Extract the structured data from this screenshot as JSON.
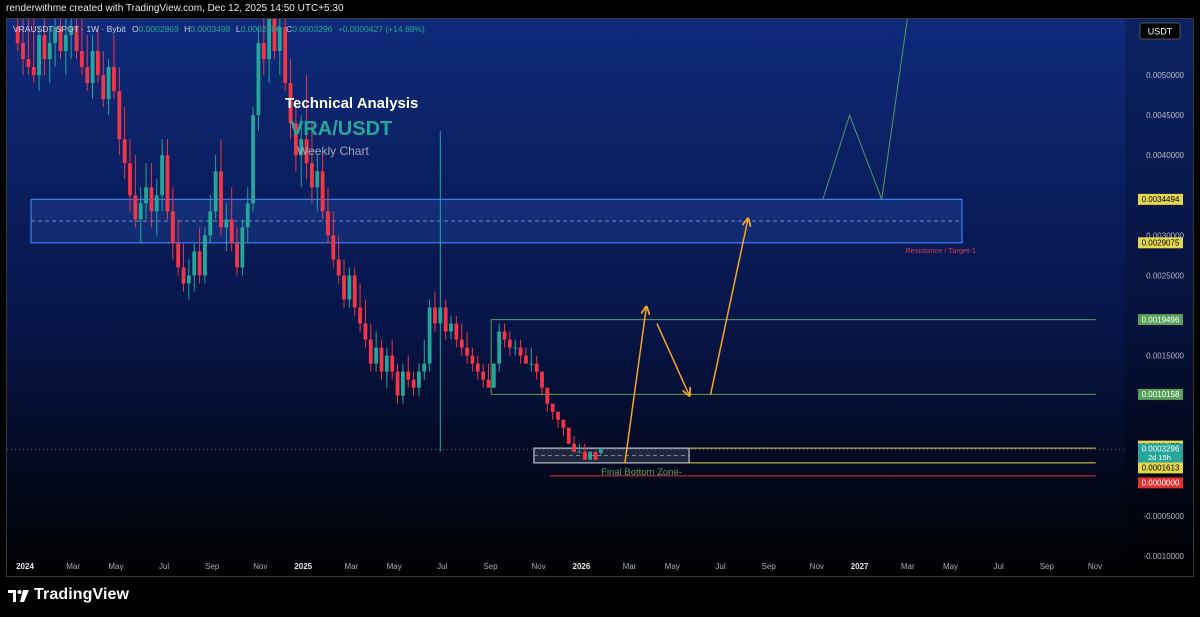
{
  "header_text": "renderwithme created with TradingView.com, Dec 12, 2025 14:50 UTC+5:30",
  "logo_text": "TradingView",
  "colors": {
    "background_top": "#0e2a7a",
    "background_bottom": "#000000",
    "up_candle": "#26a69a",
    "down_candle": "#f23645",
    "zone_border": "#3d7cf2",
    "green_line": "#5aa05a",
    "yellow_line": "#e5d84f",
    "orange_arrow": "#f5a623",
    "red_line": "#e03030"
  },
  "chart_data": {
    "type": "candlestick",
    "symbol_line": "VRAUSDT SPOT · 1W · Bybit",
    "ohlc_line": {
      "O": "0.0002869",
      "H": "0.0003498",
      "L": "0.0002486",
      "C": "0.0003296",
      "change": "+0.0000427 (+14.88%)"
    },
    "currency_badge": "USDT",
    "title": "Technical Analysis",
    "pair": "VRA/USDT",
    "subtitle": "Weekly Chart",
    "y_axis": {
      "ylim": [
        -0.00125,
        0.0057
      ],
      "ticks": [
        "0.0050000",
        "0.0045000",
        "0.0040000",
        "0.0030000",
        "0.0025000",
        "0.0015000",
        "-0.0005000",
        "-0.0010000"
      ],
      "tick_values": [
        0.005,
        0.0045,
        0.004,
        0.003,
        0.0025,
        0.0015,
        -0.0005,
        -0.001
      ]
    },
    "x_axis": {
      "labels": [
        "2024",
        "Mar",
        "May",
        "Jul",
        "Sep",
        "Nov",
        "2025",
        "Mar",
        "May",
        "Jul",
        "Sep",
        "Nov",
        "2026",
        "Mar",
        "May",
        "Jul",
        "Sep",
        "Nov",
        "2027",
        "Mar",
        "May",
        "Jul",
        "Sep",
        "Nov"
      ],
      "bold": [
        true,
        false,
        false,
        false,
        false,
        false,
        true,
        false,
        false,
        false,
        false,
        false,
        true,
        false,
        false,
        false,
        false,
        false,
        true,
        false,
        false,
        false,
        false,
        false
      ],
      "label_weeks": [
        0,
        9,
        17,
        26,
        35,
        44,
        52,
        61,
        69,
        78,
        87,
        96,
        104,
        113,
        121,
        130,
        139,
        148,
        156,
        165,
        173,
        182,
        191,
        200
      ]
    },
    "price_labels": [
      {
        "text": "0.0034494",
        "value": 0.0034494,
        "style": "yellow"
      },
      {
        "text": "0.0029075",
        "value": 0.0029075,
        "style": "yellow"
      },
      {
        "text": "0.0019496",
        "value": 0.0019496,
        "style": "green"
      },
      {
        "text": "0.0010158",
        "value": 0.0010158,
        "style": "green"
      },
      {
        "text": "0.0003455",
        "value": 0.0003455,
        "style": "yellow"
      },
      {
        "text": "0.0003296",
        "value": 0.0003296,
        "style": "teal",
        "sub": "2d 15h"
      },
      {
        "text": "0.0001613",
        "value": 0.0001613,
        "style": "yellow"
      },
      {
        "text": "0.0000000",
        "value": 0.0,
        "style": "red"
      }
    ],
    "zones": [
      {
        "name": "resistance",
        "label": "Resistance / Target-1",
        "top": 0.0034494,
        "bottom": 0.0029075,
        "from_week": 3,
        "to_week": 177
      },
      {
        "name": "bottom",
        "label": "Final Bottom Zone-",
        "top": 0.0003455,
        "bottom": 0.0001613,
        "from_week": 97,
        "to_week": 126
      }
    ],
    "levels": [
      {
        "value": 0.0019496,
        "from_week": 89,
        "to_week": 202,
        "style": "green"
      },
      {
        "value": 0.0010158,
        "from_week": 89,
        "to_week": 202,
        "style": "green"
      },
      {
        "value": 0.0003455,
        "from_week": 126,
        "to_week": 202,
        "style": "yellow"
      },
      {
        "value": 0.0001613,
        "from_week": 126,
        "to_week": 202,
        "style": "yellow"
      },
      {
        "value": 0.0,
        "from_week": 100,
        "to_week": 202,
        "style": "red"
      }
    ],
    "projection_path": [
      {
        "week": 114,
        "price": 0.0001613
      },
      {
        "week": 118,
        "price": 0.0021
      }
    ],
    "projection_path_2": [
      {
        "week": 120,
        "price": 0.0019
      },
      {
        "week": 126,
        "price": 0.00101
      }
    ],
    "projection_path_3": [
      {
        "week": 130,
        "price": 0.00101
      },
      {
        "week": 137,
        "price": 0.0032
      }
    ],
    "target_path": [
      {
        "week": 151,
        "price": 0.0034494
      },
      {
        "week": 156,
        "price": 0.0045
      },
      {
        "week": 162,
        "price": 0.0034494
      },
      {
        "week": 167,
        "price": 0.0058
      }
    ],
    "candles": [
      {
        "o": 0.0056,
        "h": 0.0059,
        "l": 0.0053,
        "c": 0.0054
      },
      {
        "o": 0.0054,
        "h": 0.0058,
        "l": 0.005,
        "c": 0.0052
      },
      {
        "o": 0.0052,
        "h": 0.0057,
        "l": 0.005,
        "c": 0.0051
      },
      {
        "o": 0.0051,
        "h": 0.0058,
        "l": 0.0049,
        "c": 0.005
      },
      {
        "o": 0.005,
        "h": 0.0056,
        "l": 0.0048,
        "c": 0.0055
      },
      {
        "o": 0.0055,
        "h": 0.0059,
        "l": 0.005,
        "c": 0.0052
      },
      {
        "o": 0.0052,
        "h": 0.0056,
        "l": 0.0049,
        "c": 0.0054
      },
      {
        "o": 0.0054,
        "h": 0.0058,
        "l": 0.0051,
        "c": 0.0056
      },
      {
        "o": 0.0056,
        "h": 0.0059,
        "l": 0.0052,
        "c": 0.0053
      },
      {
        "o": 0.0053,
        "h": 0.0057,
        "l": 0.005,
        "c": 0.0055
      },
      {
        "o": 0.0055,
        "h": 0.0059,
        "l": 0.0052,
        "c": 0.0056
      },
      {
        "o": 0.0056,
        "h": 0.0059,
        "l": 0.0052,
        "c": 0.0053
      },
      {
        "o": 0.0053,
        "h": 0.0057,
        "l": 0.005,
        "c": 0.0051
      },
      {
        "o": 0.0051,
        "h": 0.0055,
        "l": 0.0048,
        "c": 0.0049
      },
      {
        "o": 0.0049,
        "h": 0.0055,
        "l": 0.0047,
        "c": 0.0053
      },
      {
        "o": 0.0053,
        "h": 0.0056,
        "l": 0.0049,
        "c": 0.005
      },
      {
        "o": 0.005,
        "h": 0.0053,
        "l": 0.0046,
        "c": 0.0047
      },
      {
        "o": 0.0047,
        "h": 0.0052,
        "l": 0.0045,
        "c": 0.0051
      },
      {
        "o": 0.0051,
        "h": 0.0055,
        "l": 0.0047,
        "c": 0.0048
      },
      {
        "o": 0.0048,
        "h": 0.0051,
        "l": 0.004,
        "c": 0.0042
      },
      {
        "o": 0.0042,
        "h": 0.0046,
        "l": 0.0037,
        "c": 0.0039
      },
      {
        "o": 0.0039,
        "h": 0.0042,
        "l": 0.0033,
        "c": 0.0035
      },
      {
        "o": 0.0035,
        "h": 0.004,
        "l": 0.0031,
        "c": 0.0032
      },
      {
        "o": 0.0032,
        "h": 0.0036,
        "l": 0.0029,
        "c": 0.0034
      },
      {
        "o": 0.0034,
        "h": 0.0039,
        "l": 0.0032,
        "c": 0.0036
      },
      {
        "o": 0.0036,
        "h": 0.0039,
        "l": 0.0031,
        "c": 0.0033
      },
      {
        "o": 0.0033,
        "h": 0.0037,
        "l": 0.003,
        "c": 0.0035
      },
      {
        "o": 0.0035,
        "h": 0.0042,
        "l": 0.0033,
        "c": 0.004
      },
      {
        "o": 0.004,
        "h": 0.0042,
        "l": 0.0032,
        "c": 0.0033
      },
      {
        "o": 0.0033,
        "h": 0.0036,
        "l": 0.0027,
        "c": 0.0029
      },
      {
        "o": 0.0029,
        "h": 0.0032,
        "l": 0.0025,
        "c": 0.0026
      },
      {
        "o": 0.0026,
        "h": 0.0029,
        "l": 0.0023,
        "c": 0.0024
      },
      {
        "o": 0.0024,
        "h": 0.0027,
        "l": 0.0022,
        "c": 0.0025
      },
      {
        "o": 0.0025,
        "h": 0.0029,
        "l": 0.0023,
        "c": 0.0028
      },
      {
        "o": 0.0028,
        "h": 0.0031,
        "l": 0.0024,
        "c": 0.0025
      },
      {
        "o": 0.0025,
        "h": 0.0031,
        "l": 0.0024,
        "c": 0.003
      },
      {
        "o": 0.003,
        "h": 0.0035,
        "l": 0.0029,
        "c": 0.0033
      },
      {
        "o": 0.0033,
        "h": 0.004,
        "l": 0.0032,
        "c": 0.0038
      },
      {
        "o": 0.0038,
        "h": 0.0042,
        "l": 0.003,
        "c": 0.0031
      },
      {
        "o": 0.0031,
        "h": 0.0034,
        "l": 0.0028,
        "c": 0.0032
      },
      {
        "o": 0.0032,
        "h": 0.0036,
        "l": 0.0028,
        "c": 0.0029
      },
      {
        "o": 0.0029,
        "h": 0.0031,
        "l": 0.0025,
        "c": 0.0026
      },
      {
        "o": 0.0026,
        "h": 0.0032,
        "l": 0.0025,
        "c": 0.0031
      },
      {
        "o": 0.0031,
        "h": 0.0036,
        "l": 0.0029,
        "c": 0.0034
      },
      {
        "o": 0.0034,
        "h": 0.0046,
        "l": 0.0033,
        "c": 0.0045
      },
      {
        "o": 0.0045,
        "h": 0.0056,
        "l": 0.0043,
        "c": 0.0054
      },
      {
        "o": 0.0054,
        "h": 0.0059,
        "l": 0.005,
        "c": 0.0052
      },
      {
        "o": 0.0052,
        "h": 0.0059,
        "l": 0.0049,
        "c": 0.0057
      },
      {
        "o": 0.0057,
        "h": 0.0059,
        "l": 0.0052,
        "c": 0.0053
      },
      {
        "o": 0.0053,
        "h": 0.0059,
        "l": 0.005,
        "c": 0.0056
      },
      {
        "o": 0.0056,
        "h": 0.0059,
        "l": 0.0048,
        "c": 0.0049
      },
      {
        "o": 0.0049,
        "h": 0.0052,
        "l": 0.0042,
        "c": 0.0044
      },
      {
        "o": 0.0044,
        "h": 0.0047,
        "l": 0.0038,
        "c": 0.004
      },
      {
        "o": 0.004,
        "h": 0.0045,
        "l": 0.0036,
        "c": 0.0042
      },
      {
        "o": 0.0042,
        "h": 0.005,
        "l": 0.0037,
        "c": 0.0039
      },
      {
        "o": 0.0039,
        "h": 0.0044,
        "l": 0.0034,
        "c": 0.0036
      },
      {
        "o": 0.0036,
        "h": 0.004,
        "l": 0.0033,
        "c": 0.0038
      },
      {
        "o": 0.0038,
        "h": 0.004,
        "l": 0.0032,
        "c": 0.0033
      },
      {
        "o": 0.0033,
        "h": 0.0036,
        "l": 0.0029,
        "c": 0.003
      },
      {
        "o": 0.003,
        "h": 0.0033,
        "l": 0.0026,
        "c": 0.0027
      },
      {
        "o": 0.0027,
        "h": 0.003,
        "l": 0.0024,
        "c": 0.0025
      },
      {
        "o": 0.0025,
        "h": 0.0027,
        "l": 0.0021,
        "c": 0.0022
      },
      {
        "o": 0.0022,
        "h": 0.0026,
        "l": 0.0021,
        "c": 0.0025
      },
      {
        "o": 0.0025,
        "h": 0.0026,
        "l": 0.002,
        "c": 0.0021
      },
      {
        "o": 0.0021,
        "h": 0.0024,
        "l": 0.0018,
        "c": 0.0019
      },
      {
        "o": 0.0019,
        "h": 0.0022,
        "l": 0.0016,
        "c": 0.0017
      },
      {
        "o": 0.0017,
        "h": 0.0019,
        "l": 0.0013,
        "c": 0.0014
      },
      {
        "o": 0.0014,
        "h": 0.0018,
        "l": 0.0013,
        "c": 0.0016
      },
      {
        "o": 0.0016,
        "h": 0.0017,
        "l": 0.0012,
        "c": 0.0013
      },
      {
        "o": 0.0013,
        "h": 0.0016,
        "l": 0.0011,
        "c": 0.0015
      },
      {
        "o": 0.0015,
        "h": 0.0017,
        "l": 0.0012,
        "c": 0.0013
      },
      {
        "o": 0.0013,
        "h": 0.0014,
        "l": 0.0009,
        "c": 0.001
      },
      {
        "o": 0.001,
        "h": 0.0014,
        "l": 0.0009,
        "c": 0.0013
      },
      {
        "o": 0.0013,
        "h": 0.0015,
        "l": 0.0011,
        "c": 0.0012
      },
      {
        "o": 0.0012,
        "h": 0.0013,
        "l": 0.001,
        "c": 0.0011
      },
      {
        "o": 0.0011,
        "h": 0.0014,
        "l": 0.001,
        "c": 0.0013
      },
      {
        "o": 0.0013,
        "h": 0.0017,
        "l": 0.0012,
        "c": 0.0014
      },
      {
        "o": 0.0014,
        "h": 0.0022,
        "l": 0.0013,
        "c": 0.0021
      },
      {
        "o": 0.0021,
        "h": 0.0023,
        "l": 0.0018,
        "c": 0.0019
      },
      {
        "o": 0.0019,
        "h": 0.0043,
        "l": 0.0003,
        "c": 0.0021
      },
      {
        "o": 0.0021,
        "h": 0.0022,
        "l": 0.0017,
        "c": 0.0018
      },
      {
        "o": 0.0018,
        "h": 0.002,
        "l": 0.0017,
        "c": 0.0019
      },
      {
        "o": 0.0019,
        "h": 0.002,
        "l": 0.0016,
        "c": 0.0017
      },
      {
        "o": 0.0017,
        "h": 0.0019,
        "l": 0.0015,
        "c": 0.0016
      },
      {
        "o": 0.0016,
        "h": 0.0018,
        "l": 0.0014,
        "c": 0.0015
      },
      {
        "o": 0.0015,
        "h": 0.0016,
        "l": 0.0013,
        "c": 0.0014
      },
      {
        "o": 0.0014,
        "h": 0.0015,
        "l": 0.0012,
        "c": 0.0013
      },
      {
        "o": 0.0013,
        "h": 0.0014,
        "l": 0.0011,
        "c": 0.0012
      },
      {
        "o": 0.0012,
        "h": 0.0014,
        "l": 0.0011,
        "c": 0.0011
      },
      {
        "o": 0.0011,
        "h": 0.0014,
        "l": 0.0011,
        "c": 0.0014
      },
      {
        "o": 0.0014,
        "h": 0.0019,
        "l": 0.0013,
        "c": 0.0018
      },
      {
        "o": 0.0018,
        "h": 0.0019,
        "l": 0.0016,
        "c": 0.0017
      },
      {
        "o": 0.0017,
        "h": 0.0018,
        "l": 0.0015,
        "c": 0.0016
      },
      {
        "o": 0.0016,
        "h": 0.0017,
        "l": 0.0015,
        "c": 0.0016
      },
      {
        "o": 0.0016,
        "h": 0.0017,
        "l": 0.0014,
        "c": 0.0015
      },
      {
        "o": 0.0015,
        "h": 0.0016,
        "l": 0.0014,
        "c": 0.0014
      },
      {
        "o": 0.0014,
        "h": 0.0016,
        "l": 0.0013,
        "c": 0.0014
      },
      {
        "o": 0.0014,
        "h": 0.0015,
        "l": 0.0012,
        "c": 0.0013
      },
      {
        "o": 0.0013,
        "h": 0.0013,
        "l": 0.001,
        "c": 0.0011
      },
      {
        "o": 0.0011,
        "h": 0.0011,
        "l": 0.0008,
        "c": 0.0009
      },
      {
        "o": 0.0009,
        "h": 0.0009,
        "l": 0.0007,
        "c": 0.0008
      },
      {
        "o": 0.0008,
        "h": 0.0008,
        "l": 0.0006,
        "c": 0.0007
      },
      {
        "o": 0.0007,
        "h": 0.0007,
        "l": 0.0005,
        "c": 0.0006
      },
      {
        "o": 0.0006,
        "h": 0.0006,
        "l": 0.0004,
        "c": 0.0004
      },
      {
        "o": 0.0004,
        "h": 0.0005,
        "l": 0.0003,
        "c": 0.0003
      },
      {
        "o": 0.0003,
        "h": 0.0004,
        "l": 0.0003,
        "c": 0.0003
      },
      {
        "o": 0.0003,
        "h": 0.0004,
        "l": 0.0002,
        "c": 0.0002
      },
      {
        "o": 0.0002,
        "h": 0.0003,
        "l": 0.0002,
        "c": 0.0003
      },
      {
        "o": 0.0003,
        "h": 0.0003,
        "l": 0.0002,
        "c": 0.0002
      },
      {
        "o": 0.0002869,
        "h": 0.0003498,
        "l": 0.0002486,
        "c": 0.0003296
      }
    ]
  }
}
